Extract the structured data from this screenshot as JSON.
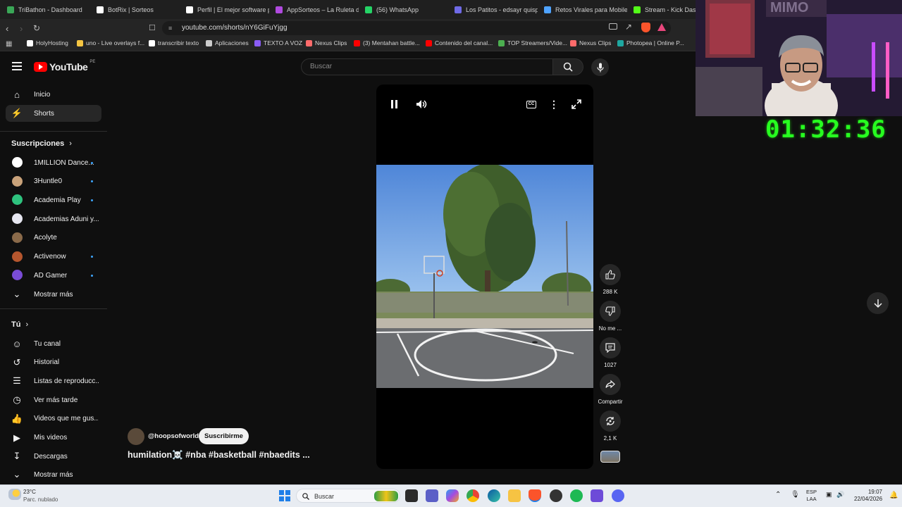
{
  "browser": {
    "tabs": [
      {
        "title": "TriBathon - Dashboard",
        "icon_color": "#3aa757"
      },
      {
        "title": "BotRix | Sorteos",
        "icon_color": "#ffffff"
      },
      {
        "title": "Perfil | El mejor software p",
        "icon_color": "#ffffff"
      },
      {
        "title": "AppSorteos – La Ruleta de",
        "icon_color": "#b04adf"
      },
      {
        "title": "(56) WhatsApp",
        "icon_color": "#25d366"
      },
      {
        "title": "Los Patitos - edsayr quisp",
        "icon_color": "#6f6ae6"
      },
      {
        "title": "Retos Virales para Mobile",
        "icon_color": "#4fa3ff"
      },
      {
        "title": "Stream - Kick Dashbo",
        "icon_color": "#53fc18"
      }
    ],
    "url": "youtube.com/shorts/nY6GiFuYjgg",
    "bookmarks": [
      {
        "label": "HolyHosting",
        "icon_color": "#ffffff"
      },
      {
        "label": "uno - Live overlays f...",
        "icon_color": "#f5c542"
      },
      {
        "label": "transcribir texto",
        "icon_color": "#ffffff"
      },
      {
        "label": "Aplicaciones",
        "icon_color": "#cccccc"
      },
      {
        "label": "TEXTO A VOZ",
        "icon_color": "#8a5cf5"
      },
      {
        "label": "Nexus Clips",
        "icon_color": "#ff6b6b"
      },
      {
        "label": "(3) Mentahan battle...",
        "icon_color": "#ff0000"
      },
      {
        "label": "Contenido del canal...",
        "icon_color": "#ff0000"
      },
      {
        "label": "TOP Streamers/Vide...",
        "icon_color": "#4caf50"
      },
      {
        "label": "Nexus Clips",
        "icon_color": "#ff6b6b"
      },
      {
        "label": "Photopea | Online P...",
        "icon_color": "#1ea7a0"
      }
    ]
  },
  "youtube": {
    "logo_text": "YouTube",
    "logo_country": "PE",
    "search_placeholder": "Buscar",
    "sidebar": {
      "main": [
        {
          "label": "Inicio",
          "icon": "home-icon"
        },
        {
          "label": "Shorts",
          "icon": "shorts-icon"
        }
      ],
      "subscriptions_title": "Suscripciones",
      "subscriptions": [
        {
          "label": "1MILLION Dance...",
          "avatar_color": "#ffffff",
          "new": true
        },
        {
          "label": "3Huntle0",
          "avatar_color": "#c9a27a",
          "new": true
        },
        {
          "label": "Academia Play",
          "avatar_color": "#2ec27e",
          "new": true
        },
        {
          "label": "Academias Aduni y...",
          "avatar_color": "#e6e6f0",
          "new": false
        },
        {
          "label": "Acolyte",
          "avatar_color": "#8a6a4a",
          "new": false
        },
        {
          "label": "Activenow",
          "avatar_color": "#b5562e",
          "new": true
        },
        {
          "label": "AD Gamer",
          "avatar_color": "#7a4cd6",
          "new": true
        }
      ],
      "show_more_1": "Mostrar más",
      "you_title": "Tú",
      "you_items": [
        {
          "label": "Tu canal",
          "icon": "channel-icon"
        },
        {
          "label": "Historial",
          "icon": "history-icon"
        },
        {
          "label": "Listas de reproducc...",
          "icon": "playlists-icon"
        },
        {
          "label": "Ver más tarde",
          "icon": "watch-later-icon"
        },
        {
          "label": "Videos que me gus...",
          "icon": "liked-videos-icon"
        },
        {
          "label": "Mis videos",
          "icon": "my-videos-icon"
        },
        {
          "label": "Descargas",
          "icon": "downloads-icon"
        }
      ],
      "show_more_2": "Mostrar más"
    },
    "short": {
      "channel": "@hoopsofworld",
      "subscribe_label": "Suscribirme",
      "title": "humilation☠️ #nba #basketball #nbaedits ...",
      "likes": "288 K",
      "dislike_label": "No me ...",
      "comments": "1027",
      "share_label": "Compartir",
      "remixes": "2,1 K"
    }
  },
  "overlay": {
    "timer": "01:32:36",
    "webcam_banner": "MIMO"
  },
  "taskbar": {
    "weather_temp": "23°C",
    "weather_desc": "Parc. nublado",
    "search_label": "Buscar",
    "lang_top": "ESP",
    "lang_bottom": "LAA",
    "time": "19:07",
    "date": "22/04/2026"
  }
}
